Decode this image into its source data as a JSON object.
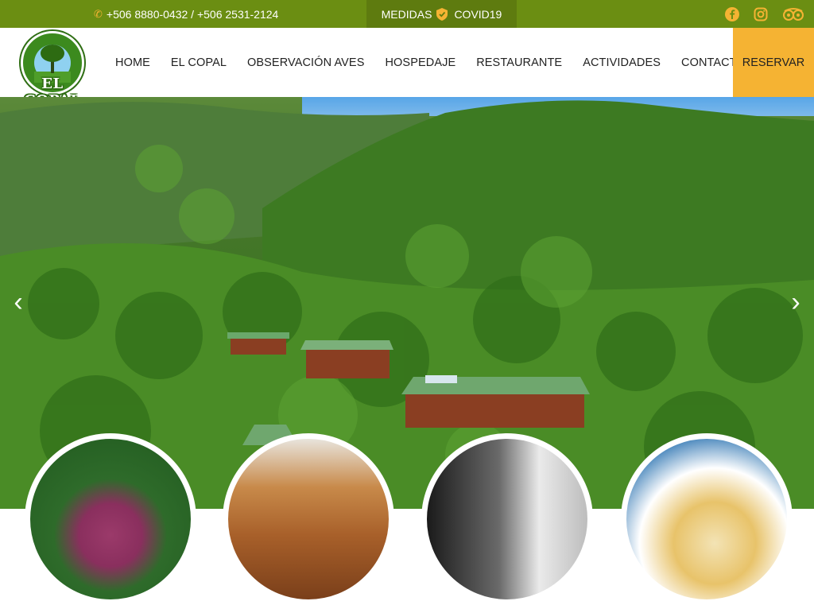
{
  "topbar": {
    "phones": "+506 8880-0432 / +506 2531-2124",
    "medidas_label": "MEDIDAS",
    "covid_label": "COVID19",
    "socials": [
      "facebook-icon",
      "instagram-icon",
      "tripadvisor-icon"
    ]
  },
  "logo": {
    "text": "EL COPAL"
  },
  "nav": {
    "items": [
      {
        "label": "HOME"
      },
      {
        "label": "EL COPAL"
      },
      {
        "label": "OBSERVACIÓN AVES"
      },
      {
        "label": "HOSPEDAJE"
      },
      {
        "label": "RESTAURANTE"
      },
      {
        "label": "ACTIVIDADES"
      },
      {
        "label": "CONTACTO"
      }
    ],
    "reservar": "RESERVAR"
  },
  "colors": {
    "topbar": "#6b8e12",
    "medidas_bg": "#5e7b0f",
    "accent": "#f5b333",
    "logo_green": "#2f6e14"
  },
  "hero": {
    "prev_arrow": "‹",
    "next_arrow": "›"
  }
}
